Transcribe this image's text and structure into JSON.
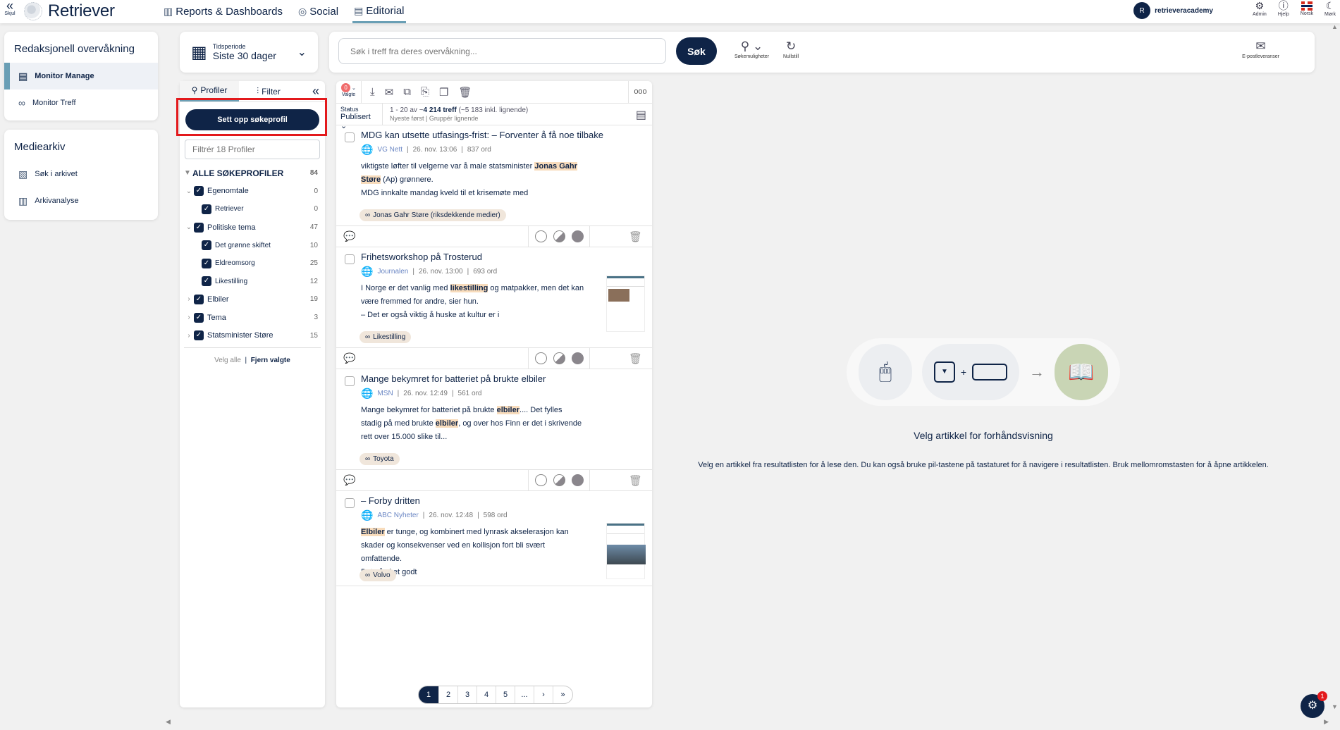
{
  "header": {
    "hide_label": "Skjul",
    "logo": "Retriever",
    "nav": [
      {
        "label": "Reports & Dashboards",
        "icon": "chart-icon"
      },
      {
        "label": "Social",
        "icon": "chat-icon"
      },
      {
        "label": "Editorial",
        "icon": "newspaper-icon",
        "active": true
      }
    ],
    "user_initial": "R",
    "user_name": "retrieveracademy",
    "icons": [
      {
        "label": "Admin",
        "icon": "gear-icon"
      },
      {
        "label": "Hjelp",
        "icon": "info-icon"
      },
      {
        "label": "Norsk",
        "icon": "norway-flag-icon"
      },
      {
        "label": "Mørk",
        "icon": "moon-icon"
      }
    ]
  },
  "sidebar": {
    "section1": {
      "title": "Redaksjonell overvåkning",
      "items": [
        {
          "label": "Monitor Manage",
          "active": true
        },
        {
          "label": "Monitor Treff"
        }
      ]
    },
    "section2": {
      "title": "Mediearkiv",
      "items": [
        {
          "label": "Søk i arkivet"
        },
        {
          "label": "Arkivanalyse"
        }
      ]
    }
  },
  "period": {
    "label": "Tidsperiode",
    "value": "Siste 30 dager"
  },
  "search": {
    "placeholder": "Søk i treff fra deres overvåkning...",
    "button": "Søk",
    "options_label": "Søkemuligheter",
    "reset_label": "Nullstill",
    "email_label": "E-postleveranser"
  },
  "profiles": {
    "tab_profiles": "Profiler",
    "tab_filter": "Filter",
    "setup_button": "Sett opp søkeprofil",
    "filter_placeholder": "Filtrér 18 Profiler",
    "root": {
      "label": "ALLE SØKEPROFILER",
      "count": "84"
    },
    "tree": [
      {
        "label": "Egenomtale",
        "count": "0",
        "level": "parent",
        "open": true
      },
      {
        "label": "Retriever",
        "count": "0",
        "level": "child"
      },
      {
        "label": "Politiske tema",
        "count": "47",
        "level": "parent",
        "open": true
      },
      {
        "label": "Det grønne skiftet",
        "count": "10",
        "level": "child"
      },
      {
        "label": "Eldreomsorg",
        "count": "25",
        "level": "child"
      },
      {
        "label": "Likestilling",
        "count": "12",
        "level": "child"
      },
      {
        "label": "Elbiler",
        "count": "19",
        "level": "parent",
        "open": false
      },
      {
        "label": "Tema",
        "count": "3",
        "level": "parent",
        "open": false
      },
      {
        "label": "Statsminister Støre",
        "count": "15",
        "level": "parent",
        "open": false
      }
    ],
    "select_all": "Velg alle",
    "deselect": "Fjern valgte"
  },
  "results": {
    "selected_count": "0",
    "selected_label": "Valgte",
    "more": "ooo",
    "status_label": "Status",
    "status_value": "Publisert",
    "range": "1 - 20 av ~",
    "total": "4 214 treff",
    "similar": "(~5 183 inkl. lignende)",
    "sort": "Nyeste først",
    "group": "Gruppér lignende",
    "articles": [
      {
        "title": "MDG kan utsette utfasings-frist: – Forventer å få noe tilbake",
        "source": "VG Nett",
        "date": "26. nov. 13:06",
        "words": "837 ord",
        "body": [
          [
            "viktigste løfter til velgerne var å male statsminister ",
            "Jonas Gahr"
          ],
          [
            "",
            "Støre",
            " (Ap) grønnere."
          ],
          [
            "MDG innkalte mandag kveld til et krisemøte med"
          ]
        ],
        "tag": "Jonas Gahr Støre (riksdekkende medier)",
        "thumb": false
      },
      {
        "title": "Frihetsworkshop på Trosterud",
        "source": "Journalen",
        "date": "26. nov. 13:00",
        "words": "693 ord",
        "body": [
          [
            "I Norge er det vanlig med ",
            "likestilling",
            " og matpakker, men det kan"
          ],
          [
            "være fremmed for andre, sier hun."
          ],
          [
            "– Det er også viktig å huske at kultur er i"
          ]
        ],
        "tag": "Likestilling",
        "thumb": true
      },
      {
        "title": "Mange bekymret for batteriet på brukte elbiler",
        "source": "MSN",
        "date": "26. nov. 12:49",
        "words": "561 ord",
        "body": [
          [
            "Mange bekymret for batteriet på brukte ",
            "elbiler",
            ".... Det fylles"
          ],
          [
            "stadig på med brukte ",
            "elbiler",
            ", og over hos Finn er det i skrivende"
          ],
          [
            "rett over 15.000 slike til..."
          ]
        ],
        "tag": "Toyota",
        "thumb": false
      },
      {
        "title": "– Forby dritten",
        "source": "ABC Nyheter",
        "date": "26. nov. 12:48",
        "words": "598 ord",
        "body": [
          [
            "",
            "Elbiler",
            " er tunge, og kombinert med lynrask akselerasjon kan"
          ],
          [
            "skader og konsekvenser ved en kollisjon fort bli svært"
          ],
          [
            "omfattende."
          ],
          [
            "Det så vi et godt"
          ]
        ],
        "tag": "Volvo",
        "thumb": true
      }
    ],
    "pages": [
      "1",
      "2",
      "3",
      "4",
      "5",
      "...",
      "›",
      "»"
    ],
    "current_page": "1"
  },
  "preview": {
    "title": "Velg artikkel for forhåndsvisning",
    "description": "Velg en artikkel fra resultatlisten for å lese den. Du kan også bruke pil-tastene på tastaturet for å navigere i resultatlisten. Bruk mellomromstasten for å åpne artikkelen.",
    "plus": "+"
  },
  "help_badge": "1"
}
